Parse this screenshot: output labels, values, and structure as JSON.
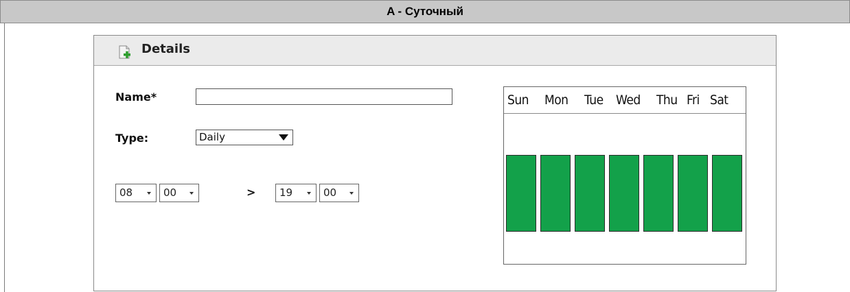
{
  "window": {
    "title": "A - Суточный"
  },
  "details": {
    "title": "Details",
    "icon": "add-document-icon",
    "name_label": "Name*",
    "name_value": "",
    "name_placeholder": "",
    "type_label": "Type:",
    "type_value": "Daily",
    "start_hour": "08",
    "start_minute": "00",
    "separator": ">",
    "end_hour": "19",
    "end_minute": "00"
  },
  "week": {
    "days": [
      {
        "label": "Sun",
        "active": true
      },
      {
        "label": "Mon",
        "active": true
      },
      {
        "label": "Tue",
        "active": true
      },
      {
        "label": "Wed",
        "active": true
      },
      {
        "label": "Thu",
        "active": true
      },
      {
        "label": "Fri",
        "active": true
      },
      {
        "label": "Sat",
        "active": true
      }
    ],
    "active_color": "#13a14a"
  }
}
